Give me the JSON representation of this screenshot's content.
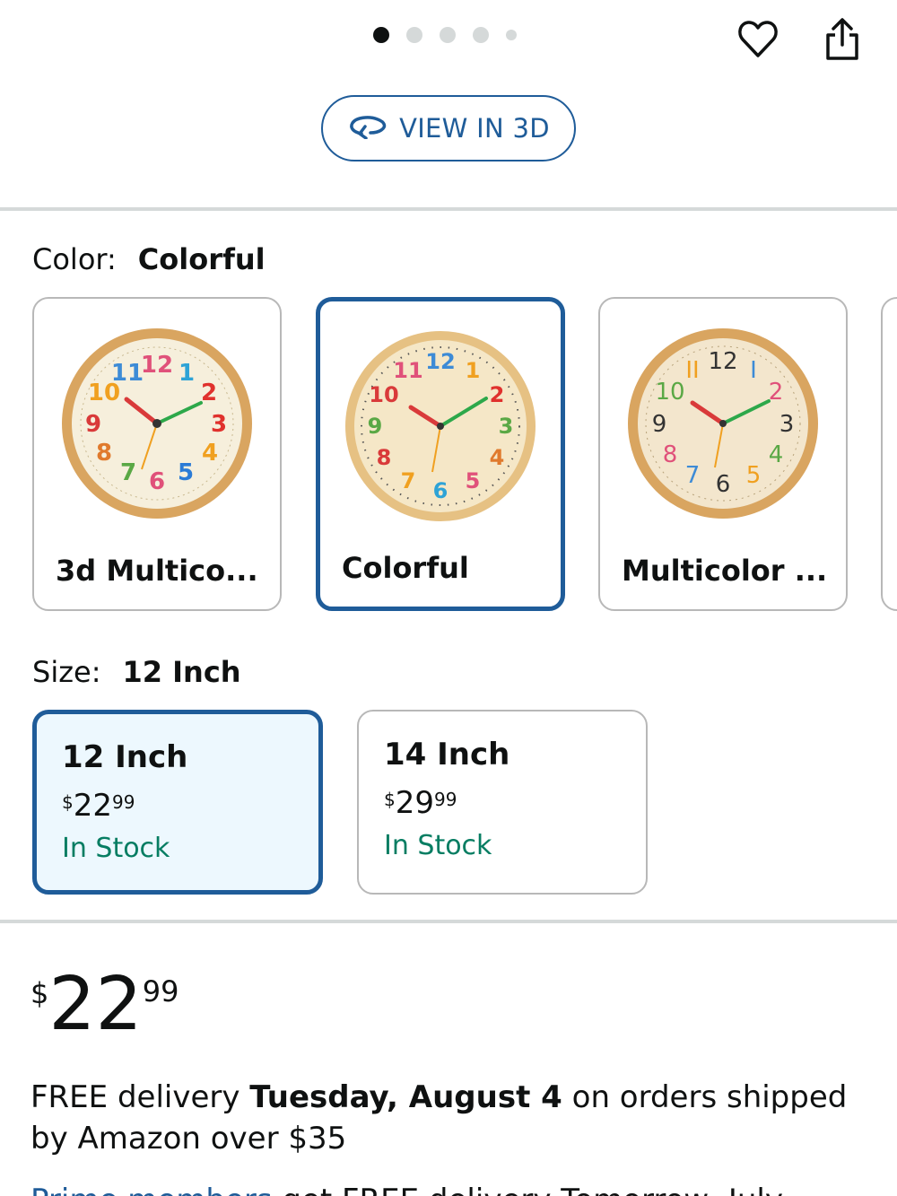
{
  "carousel": {
    "total": 5,
    "active": 0
  },
  "header": {
    "favorite_icon": "heart-icon",
    "share_icon": "share-icon"
  },
  "view3d": {
    "label": "VIEW IN 3D",
    "icon": "rotate-3d-icon"
  },
  "color": {
    "label": "Color:",
    "selected": "Colorful",
    "options": [
      {
        "label": "3d Multico...",
        "selected": false
      },
      {
        "label": "Colorful",
        "selected": true
      },
      {
        "label": "Multicolor ...",
        "selected": false
      }
    ]
  },
  "size": {
    "label": "Size:",
    "selected": "12 Inch",
    "options": [
      {
        "label": "12 Inch",
        "currency": "$",
        "whole": "22",
        "cents": "99",
        "stock": "In Stock",
        "selected": true
      },
      {
        "label": "14 Inch",
        "currency": "$",
        "whole": "29",
        "cents": "99",
        "stock": "In Stock",
        "selected": false
      }
    ]
  },
  "price": {
    "currency": "$",
    "whole": "22",
    "cents": "99"
  },
  "delivery": {
    "prefix": "FREE delivery ",
    "date": "Tuesday, August 4",
    "suffix": " on orders shipped by Amazon over $35"
  },
  "cut_line": {
    "prime": "Prime members",
    "rest": " get FREE delivery Tomorrow, July"
  },
  "colors": {
    "accent": "#1f5c99",
    "stock": "#067d62",
    "selected_bg": "#edf8fe",
    "divider": "#d5d9d9"
  }
}
